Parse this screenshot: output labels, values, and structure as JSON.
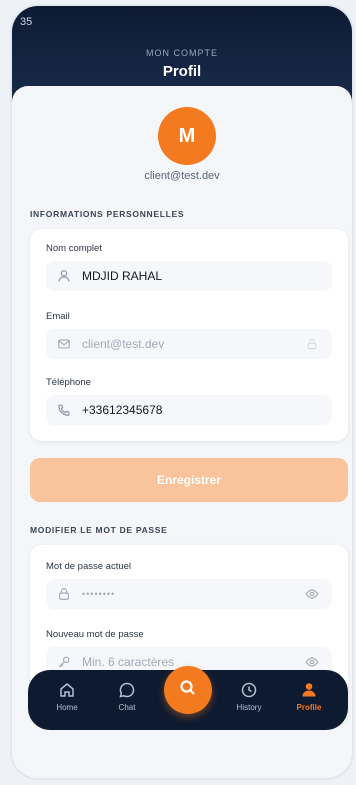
{
  "status_bar": {
    "time": "35"
  },
  "header": {
    "kicker": "MON COMPTE",
    "title": "Profil"
  },
  "profile": {
    "avatar_initial": "M",
    "email": "client@test.dev"
  },
  "personal_info": {
    "section_title": "INFORMATIONS PERSONNELLES",
    "name_label": "Nom complet",
    "name_value": "MDJID RAHAL",
    "email_label": "Email",
    "email_value": "client@test.dev",
    "phone_label": "Téléphone",
    "phone_value": "+33612345678"
  },
  "save_label": "Enregistrer",
  "password": {
    "section_title": "MODIFIER LE MOT DE PASSE",
    "current_label": "Mot de passe actuel",
    "current_value": "••••••••",
    "new_label": "Nouveau mot de passe",
    "new_placeholder": "Min. 6 caractères"
  },
  "nav": {
    "home": "Home",
    "chat": "Chat",
    "history": "History",
    "profile": "Profile"
  },
  "colors": {
    "accent": "#f47a20",
    "header_dark": "#0d1a33",
    "nav_bg": "#0e1a30",
    "save_disabled": "#f9c39b"
  },
  "icons": {
    "name_field": "user-icon",
    "email_field": "mail-icon",
    "email_lock": "lock-icon",
    "phone_field": "phone-icon",
    "current_password": "lock-icon",
    "new_password": "key-icon",
    "visibility": "eye-icon",
    "fab": "search-icon"
  }
}
